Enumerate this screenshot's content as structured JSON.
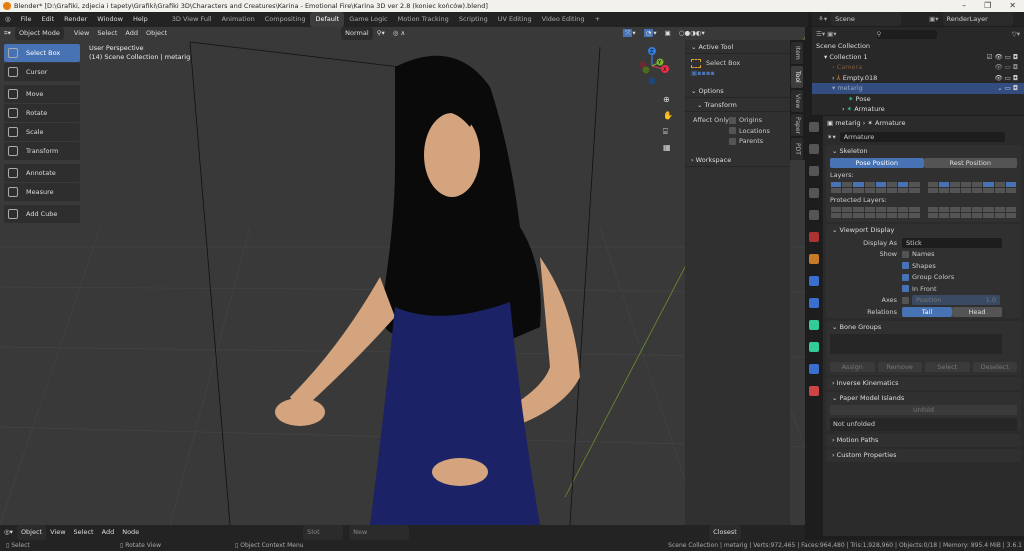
{
  "window": {
    "title": "Blender* [D:\\Grafiki, zdjecia i tapety\\Grafiki\\Grafiki 3D\\Characters and Creatures\\Karina - Emotional Fire\\Karina 3D ver 2.8 (koniec końców).blend]",
    "min": "–",
    "max": "❐",
    "close": "✕"
  },
  "menu": [
    "File",
    "Edit",
    "Render",
    "Window",
    "Help"
  ],
  "workspaces": [
    {
      "label": "3D View Full"
    },
    {
      "label": "Animation"
    },
    {
      "label": "Compositing"
    },
    {
      "label": "Default",
      "active": true
    },
    {
      "label": "Game Logic"
    },
    {
      "label": "Motion Tracking"
    },
    {
      "label": "Scripting"
    },
    {
      "label": "UV Editing"
    },
    {
      "label": "Video Editing"
    },
    {
      "label": "+"
    }
  ],
  "scene": {
    "name": "Scene",
    "render_layer": "RenderLayer"
  },
  "viewport_header": {
    "mode": "Object Mode",
    "menus": [
      "View",
      "Select",
      "Add",
      "Object"
    ],
    "orientation": "Normal"
  },
  "viewport_info": {
    "line1": "User Perspective",
    "line2": "(14) Scene Collection | metarig"
  },
  "tools": [
    "Select Box",
    "Cursor",
    "Move",
    "Rotate",
    "Scale",
    "Transform",
    "Annotate",
    "Measure",
    "Add Cube"
  ],
  "gizmo": {
    "x": "X",
    "y": "Y",
    "z": "Z"
  },
  "npanel": {
    "active_tool": "Active Tool",
    "tool_name": "Select Box",
    "options": "Options",
    "transform": "Transform",
    "affect_only": "Affect Only",
    "origins": "Origins",
    "locations": "Locations",
    "parents": "Parents",
    "workspace": "Workspace",
    "tabs": [
      "Item",
      "Tool",
      "View",
      "Paper",
      "PDT"
    ]
  },
  "outliner": {
    "rows": [
      {
        "label": "Scene Collection"
      },
      {
        "label": "Collection 1"
      },
      {
        "label": "Camera"
      },
      {
        "label": "Empty.018"
      },
      {
        "label": "metarig",
        "selected": true
      },
      {
        "label": "Pose"
      },
      {
        "label": "Armature"
      }
    ]
  },
  "properties": {
    "breadcrumb": {
      "object": "metarig",
      "data": "Armature"
    },
    "data_name": "Armature",
    "skeleton": {
      "title": "Skeleton",
      "pose": "Pose Position",
      "rest": "Rest Position",
      "layers": "Layers:",
      "protected": "Protected Layers:"
    },
    "layers_on": [
      0,
      2,
      4,
      6,
      9,
      13,
      15
    ],
    "viewport_display": {
      "title": "Viewport Display",
      "display_as_label": "Display As",
      "display_as": "Stick",
      "show": "Show",
      "names": "Names",
      "names_on": false,
      "shapes": "Shapes",
      "shapes_on": true,
      "group_colors": "Group Colors",
      "group_colors_on": true,
      "in_front": "In Front",
      "in_front_on": true,
      "axes": "Axes",
      "position": "Position",
      "position_value": "1.0",
      "relations": "Relations",
      "tail": "Tail",
      "head": "Head"
    },
    "bone_groups": {
      "title": "Bone Groups",
      "assign": "Assign",
      "remove": "Remove",
      "select": "Select",
      "deselect": "Deselect"
    },
    "inverse_kinematics": "Inverse Kinematics",
    "paper_model": {
      "title": "Paper Model Islands",
      "unfold": "Unfold",
      "status": "Not unfolded"
    },
    "motion_paths": "Motion Paths",
    "custom_properties": "Custom Properties"
  },
  "node_header": {
    "type": "Object",
    "menus": [
      "View",
      "Select",
      "Add",
      "Node"
    ],
    "slot": "Slot",
    "new": "New",
    "snap": "Closest"
  },
  "status": {
    "select": "Select",
    "rotate": "Rotate View",
    "context": "Object Context Menu",
    "stats": "Scene Collection | metarig | Verts:972,465 | Faces:964,480 | Tris:1,928,960 | Objects:0/18 | Memory: 895.4 MiB | 3.6.1"
  },
  "colors": {
    "accent": "#4772b3",
    "dress": "#1c2266",
    "skin": "#d4a47e",
    "hair": "#0a0a0a"
  }
}
